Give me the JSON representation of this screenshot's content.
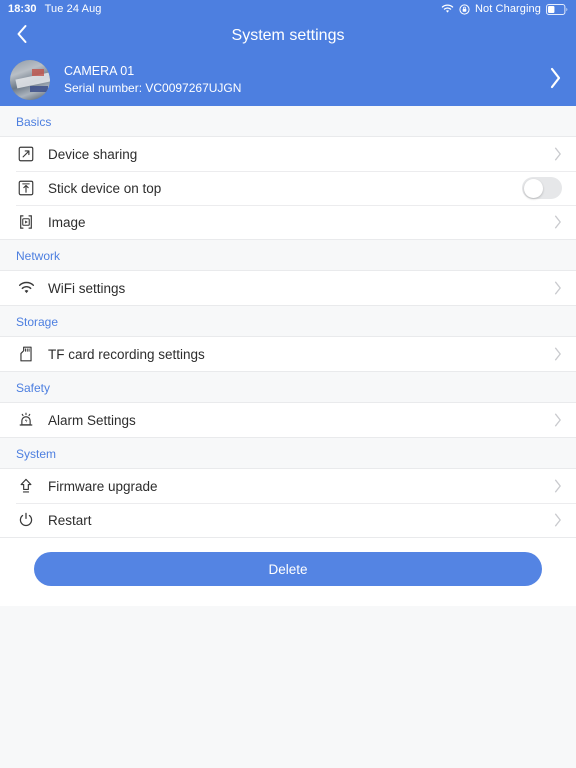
{
  "status_bar": {
    "time": "18:30",
    "date": "Tue 24 Aug",
    "wifi_icon": "wifi-icon",
    "orientation_lock_icon": "orientation-lock-icon",
    "charging_text": "Not Charging",
    "battery_icon": "battery-icon"
  },
  "nav": {
    "back_icon": "chevron-left-icon",
    "title": "System settings"
  },
  "device": {
    "name": "CAMERA 01",
    "serial": "Serial number: VC0097267UJGN",
    "avatar_icon": "camera-thumbnail",
    "chevron_icon": "chevron-right-icon"
  },
  "sections": [
    {
      "title": "Basics",
      "rows": [
        {
          "label": "Device sharing",
          "icon": "share-square-icon",
          "accessory": "chevron"
        },
        {
          "label": "Stick device on top",
          "icon": "pin-top-icon",
          "accessory": "toggle",
          "toggle_on": false
        },
        {
          "label": "Image",
          "icon": "image-play-icon",
          "accessory": "chevron"
        }
      ]
    },
    {
      "title": "Network",
      "rows": [
        {
          "label": "WiFi settings",
          "icon": "wifi-icon",
          "accessory": "chevron"
        }
      ]
    },
    {
      "title": "Storage",
      "rows": [
        {
          "label": "TF card recording settings",
          "icon": "sd-card-icon",
          "accessory": "chevron"
        }
      ]
    },
    {
      "title": "Safety",
      "rows": [
        {
          "label": "Alarm Settings",
          "icon": "alarm-siren-icon",
          "accessory": "chevron"
        }
      ]
    },
    {
      "title": "System",
      "rows": [
        {
          "label": "Firmware upgrade",
          "icon": "upload-arrow-icon",
          "accessory": "chevron"
        },
        {
          "label": "Restart",
          "icon": "power-icon",
          "accessory": "chevron"
        }
      ]
    }
  ],
  "footer": {
    "delete_label": "Delete"
  },
  "colors": {
    "accent": "#4d7fe0",
    "button": "#5484e3",
    "page_bg": "#f7f8f9",
    "row_bg": "#ffffff",
    "label": "#2d2d2d"
  }
}
